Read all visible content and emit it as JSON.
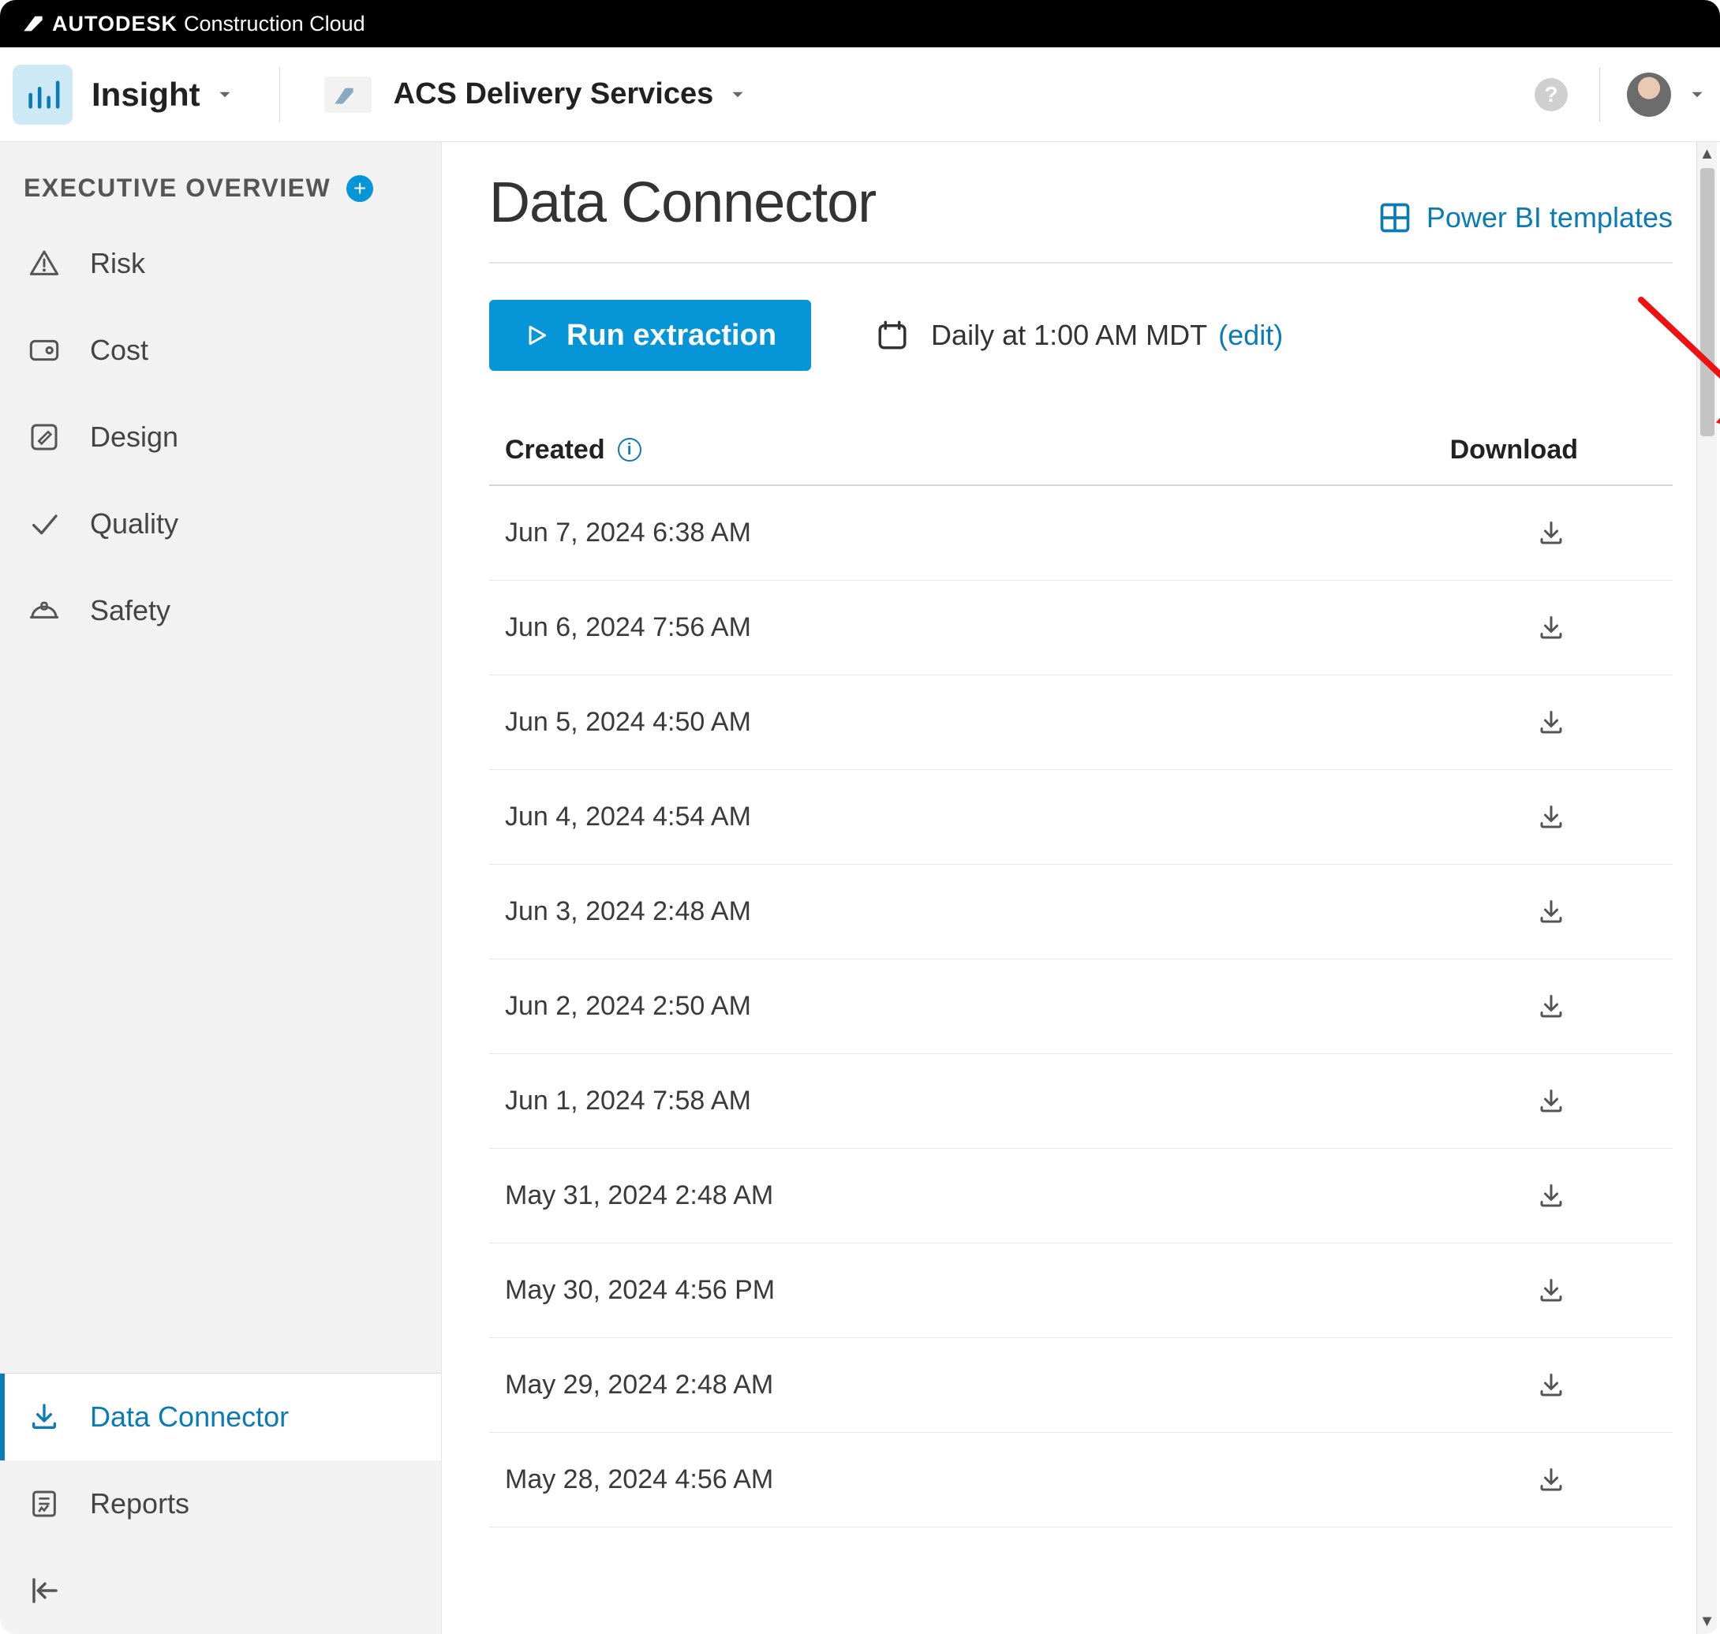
{
  "brand": {
    "bold": "AUTODESK",
    "light": "Construction Cloud"
  },
  "topbar": {
    "tool": "Insight",
    "account": "ACS Delivery Services"
  },
  "sidebar": {
    "section_title": "EXECUTIVE OVERVIEW",
    "items": [
      {
        "label": "Risk"
      },
      {
        "label": "Cost"
      },
      {
        "label": "Design"
      },
      {
        "label": "Quality"
      },
      {
        "label": "Safety"
      }
    ],
    "tools": [
      {
        "label": "Data Connector",
        "active": true
      },
      {
        "label": "Reports",
        "active": false
      }
    ]
  },
  "page": {
    "title": "Data Connector",
    "pbi_link": "Power BI templates",
    "run_label": "Run extraction",
    "schedule_text": "Daily at 1:00 AM MDT",
    "edit_label": "(edit)"
  },
  "table": {
    "col_created": "Created",
    "col_download": "Download",
    "rows": [
      {
        "created": "Jun 7, 2024 6:38 AM"
      },
      {
        "created": "Jun 6, 2024 7:56 AM"
      },
      {
        "created": "Jun 5, 2024 4:50 AM"
      },
      {
        "created": "Jun 4, 2024 4:54 AM"
      },
      {
        "created": "Jun 3, 2024 2:48 AM"
      },
      {
        "created": "Jun 2, 2024 2:50 AM"
      },
      {
        "created": "Jun 1, 2024 7:58 AM"
      },
      {
        "created": "May 31, 2024 2:48 AM"
      },
      {
        "created": "May 30, 2024 4:56 PM"
      },
      {
        "created": "May 29, 2024 2:48 AM"
      },
      {
        "created": "May 28, 2024 4:56 AM"
      }
    ]
  }
}
